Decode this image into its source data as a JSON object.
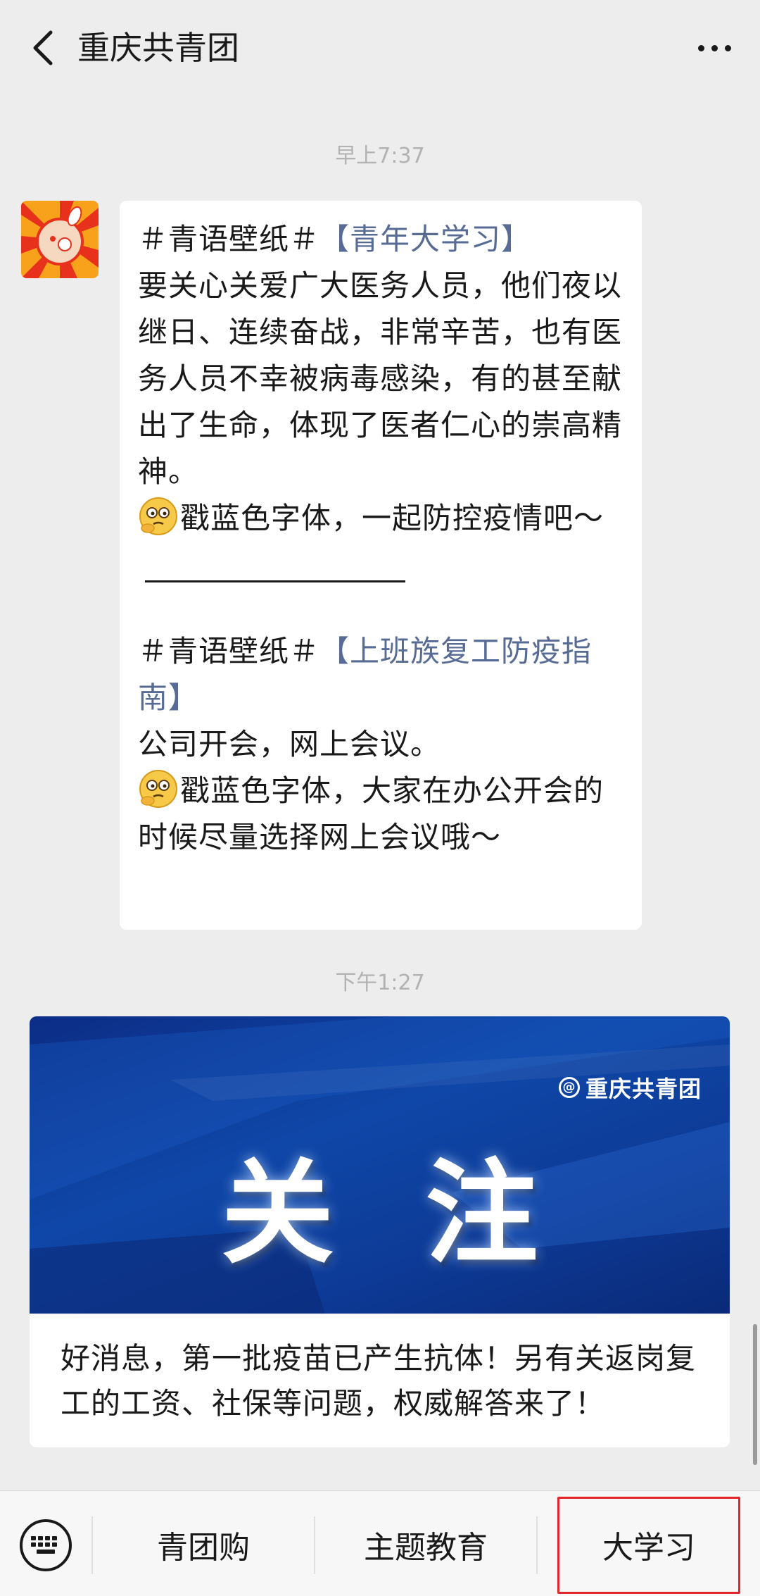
{
  "header": {
    "title": "重庆共青团",
    "back_icon": "chevron-left-icon",
    "more_icon": "more-dots-icon"
  },
  "messages": {
    "time1": "早上7:37",
    "time2": "下午1:27",
    "bubble": {
      "p1_prefix": "＃青语壁纸＃",
      "p1_link": "【青年大学习】",
      "p1_body": "要关心关爱广大医务人员，他们夜以继日、连续奋战，非常辛苦，也有医务人员不幸被病毒感染，有的甚至献出了生命，体现了医者仁心的崇高精神。",
      "p1_emoji_text": "戳蓝色字体，一起防控疫情吧～",
      "p2_prefix": "＃青语壁纸＃",
      "p2_link": "【上班族复工防疫指南】",
      "p2_body": "公司开会，网上会议。",
      "p2_emoji_text": "戳蓝色字体，大家在办公开会的时候尽量选择网上会议哦～"
    },
    "card": {
      "banner_brand": "重庆共青团",
      "banner_title": "关注",
      "text": "好消息，第一批疫苗已产生抗体！另有关返岗复工的工资、社保等问题，权威解答来了！"
    }
  },
  "bottom_menu": {
    "keyboard_icon": "keyboard-icon",
    "items": [
      "青团购",
      "主题教育",
      "大学习"
    ]
  },
  "colors": {
    "link": "#576b95",
    "highlight_border": "#e0262a",
    "background": "#ededed"
  }
}
